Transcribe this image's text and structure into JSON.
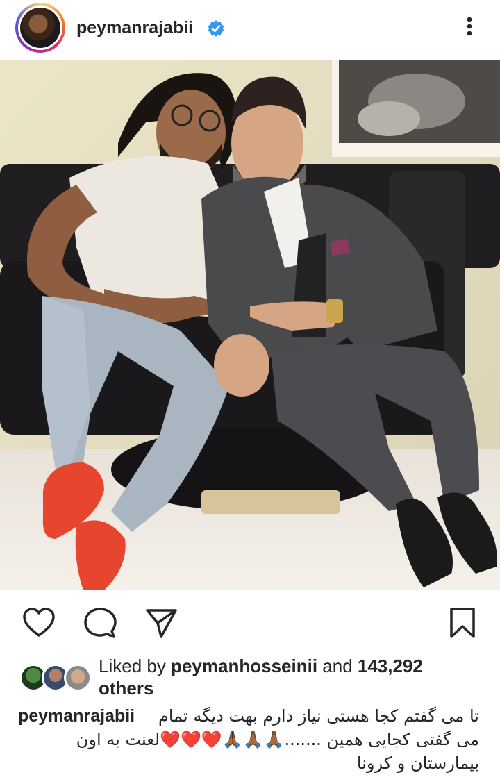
{
  "post": {
    "username": "peymanrajabii",
    "verified": true
  },
  "icons": {
    "verified": "verified-badge-icon",
    "more": "more-options-icon",
    "like": "heart-icon",
    "comment": "comment-icon",
    "share": "send-icon",
    "save": "bookmark-icon"
  },
  "likes": {
    "prefix": "Liked by ",
    "user": "peymanhosseinii",
    "middle": " and ",
    "count": "143,292",
    "suffix": "others"
  },
  "caption": {
    "username": "peymanrajabii",
    "line1": "تا می گفتم کجا هستی نیاز دارم بهت دیگه تمام",
    "line2": "می گفتی کجایی همین .......🙏🏾🙏🏾🙏🏾❤️❤️❤️لعنت به اون",
    "line3": "بیمارستان و کرونا"
  },
  "colors": {
    "verified_blue": "#3897f0",
    "text": "#262626"
  }
}
